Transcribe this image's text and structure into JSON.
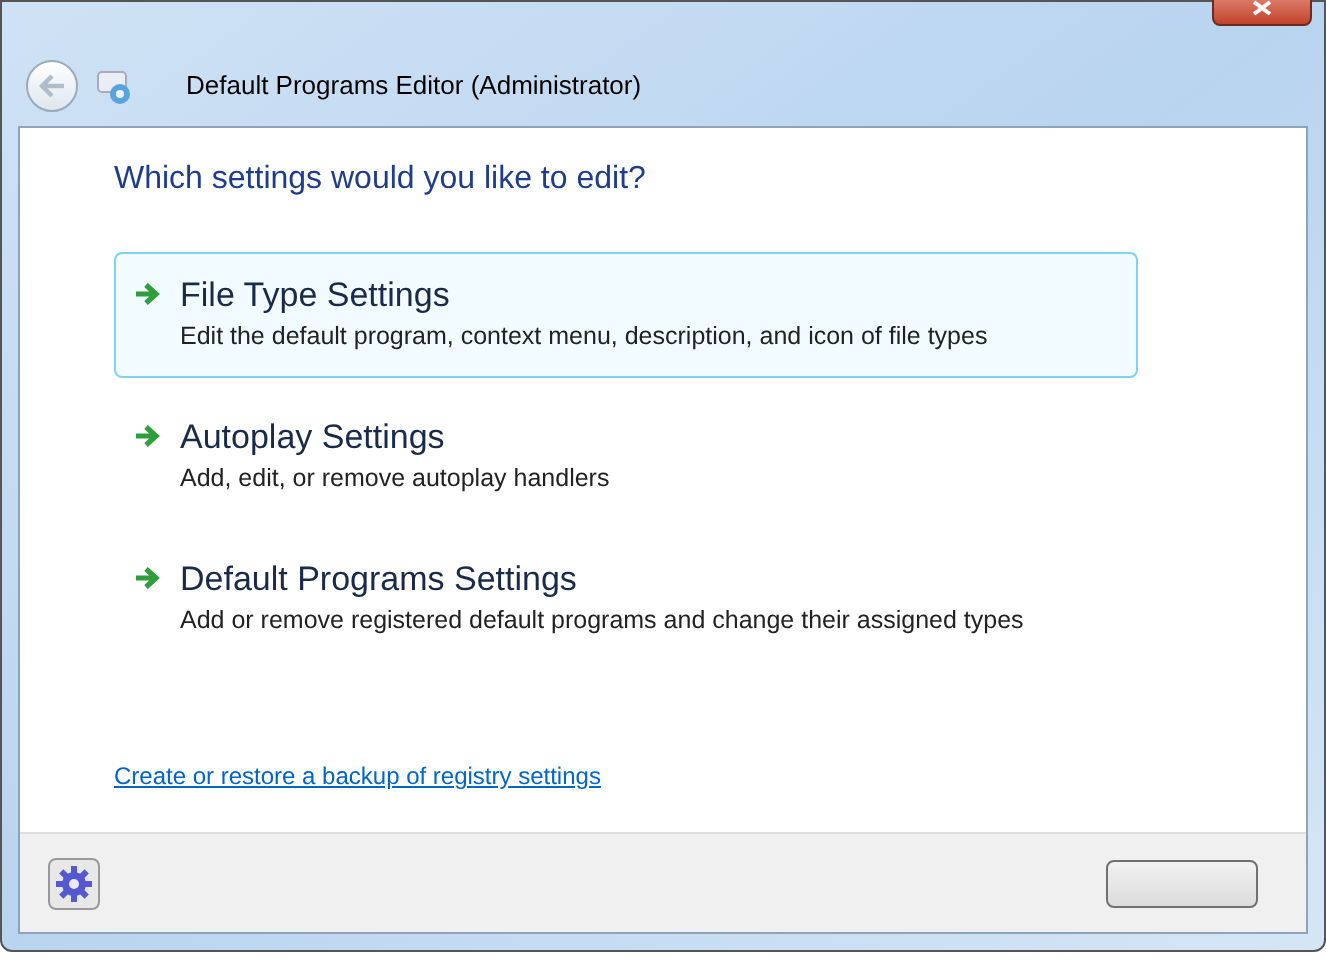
{
  "window": {
    "title": "Default Programs Editor (Administrator)"
  },
  "heading": "Which settings would you like to edit?",
  "options": [
    {
      "title": "File Type Settings",
      "description": "Edit the default program, context menu, description, and icon of file types",
      "selected": true
    },
    {
      "title": "Autoplay Settings",
      "description": "Add, edit, or remove autoplay handlers",
      "selected": false
    },
    {
      "title": "Default Programs Settings",
      "description": "Add or remove registered default programs and change their assigned types",
      "selected": false
    }
  ],
  "backup_link": "Create or restore a backup of registry settings"
}
